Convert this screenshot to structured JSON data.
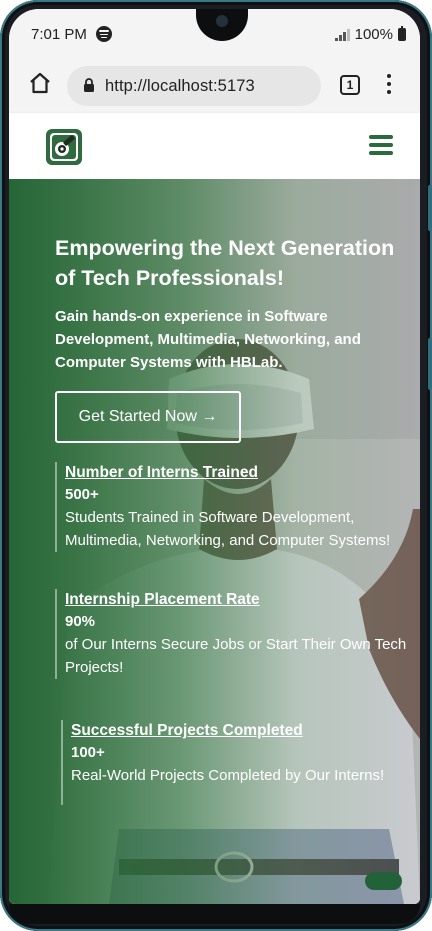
{
  "status_bar": {
    "time": "7:01 PM",
    "battery": "100%"
  },
  "browser": {
    "url": "http://localhost:5173",
    "tab_count": "1"
  },
  "colors": {
    "brand_green": "#2a6a3c",
    "overlay_green": "#266636"
  },
  "hero": {
    "title": "Empowering the Next Generation of Tech Professionals!",
    "subtitle": "Gain hands-on experience in Software Development, Multimedia, Networking, and Computer Systems with HBLab.",
    "cta_label": "Get Started Now →"
  },
  "stats": [
    {
      "title": "Number of Interns Trained",
      "value": "500+",
      "description": "Students Trained in Software Development, Multimedia, Networking, and Computer Systems!"
    },
    {
      "title": "Internship Placement Rate",
      "value": "90%",
      "description": "of Our Interns Secure Jobs or Start Their Own Tech Projects!"
    },
    {
      "title": "Successful Projects Completed",
      "value": "100+",
      "description": "Real-World Projects Completed by Our Interns!"
    }
  ]
}
